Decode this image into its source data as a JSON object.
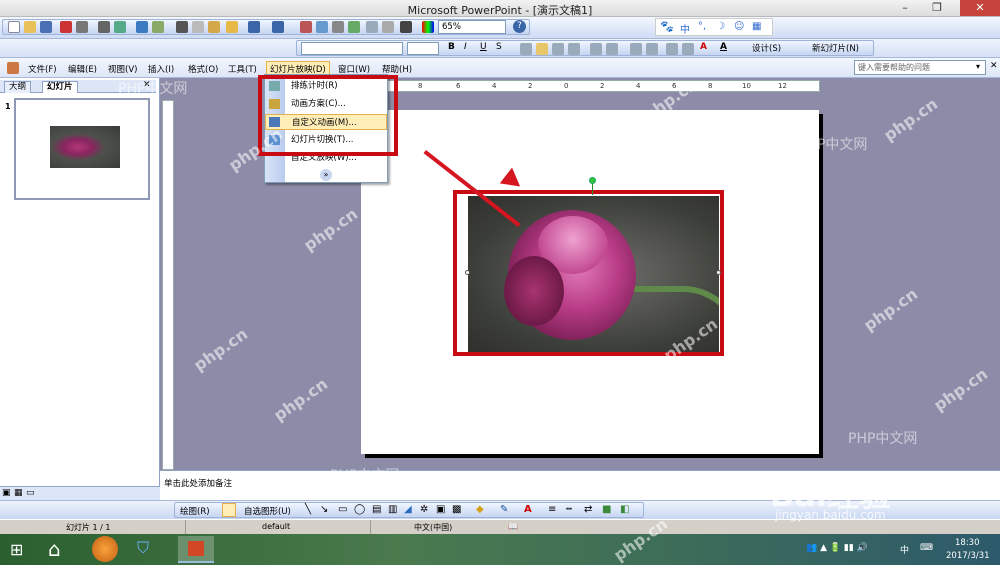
{
  "window": {
    "title": "Microsoft PowerPoint - [演示文稿1]"
  },
  "toolbar": {
    "zoom": "65%",
    "design_label": "设计(S)",
    "new_slide_label": "新幻灯片(N)"
  },
  "menu": {
    "items": [
      "文件(F)",
      "编辑(E)",
      "视图(V)",
      "插入(I)",
      "格式(O)",
      "工具(T)",
      "幻灯片放映(D)",
      "窗口(W)",
      "帮助(H)"
    ],
    "help_placeholder": "键入需要帮助的问题"
  },
  "dropdown": {
    "items": [
      "排练计时(R)",
      "动画方案(C)...",
      "自定义动画(M)...",
      "幻灯片切换(T)...",
      "自定义放映(W)..."
    ],
    "selected_index": 2
  },
  "left_panel": {
    "tabs": [
      "大纲",
      "幻灯片"
    ],
    "slide_number": "1"
  },
  "ruler": {
    "labels": [
      "10",
      "8",
      "6",
      "4",
      "2",
      "0",
      "2",
      "4",
      "6",
      "8",
      "10",
      "12"
    ]
  },
  "notes": {
    "placeholder": "单击此处添加备注"
  },
  "drawbar": {
    "draw_label": "绘图(R)",
    "autoshape_label": "自选图形(U)"
  },
  "statusbar": {
    "slide": "幻灯片 1 / 1",
    "design": "default",
    "language": "中文(中国)"
  },
  "taskbar": {
    "time": "18:30",
    "date": "2017/3/31",
    "ime": "中"
  },
  "ime_bar": {
    "label": "中"
  },
  "watermarks": {
    "site": "php.cn",
    "cn": "PHP中文网",
    "baidu": "Bai经验",
    "baidu_url": "jingyan.baidu.com"
  },
  "colors": {
    "highlight": "#c80a12",
    "menu_selected": "#ffeeb8"
  }
}
